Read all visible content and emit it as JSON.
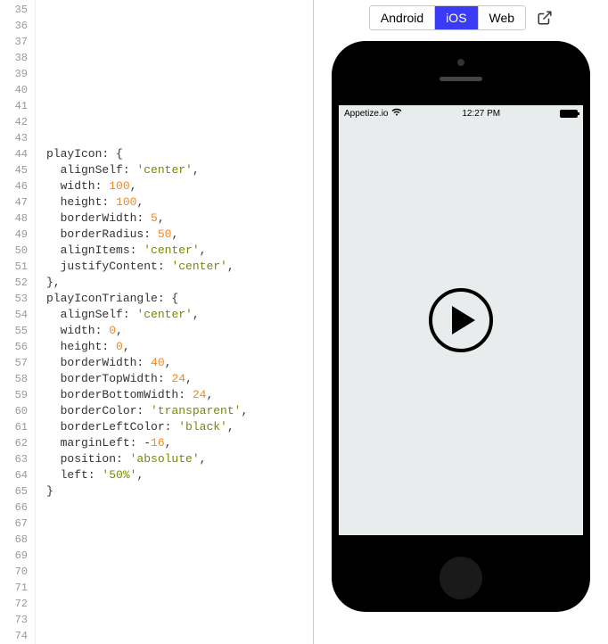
{
  "editor": {
    "startLine": 35,
    "endLine": 74,
    "lines": [
      {
        "tokens": []
      },
      {
        "tokens": []
      },
      {
        "tokens": []
      },
      {
        "tokens": []
      },
      {
        "tokens": []
      },
      {
        "tokens": []
      },
      {
        "tokens": []
      },
      {
        "tokens": []
      },
      {
        "tokens": []
      },
      {
        "tokens": [
          {
            "t": "key",
            "v": "playIcon"
          },
          {
            "t": "punc",
            "v": ": {"
          }
        ]
      },
      {
        "tokens": [
          {
            "t": "prop",
            "v": "  alignSelf"
          },
          {
            "t": "punc",
            "v": ": "
          },
          {
            "t": "str",
            "v": "'center'"
          },
          {
            "t": "punc",
            "v": ","
          }
        ]
      },
      {
        "tokens": [
          {
            "t": "prop",
            "v": "  width"
          },
          {
            "t": "punc",
            "v": ": "
          },
          {
            "t": "num",
            "v": "100"
          },
          {
            "t": "punc",
            "v": ","
          }
        ]
      },
      {
        "tokens": [
          {
            "t": "prop",
            "v": "  height"
          },
          {
            "t": "punc",
            "v": ": "
          },
          {
            "t": "num",
            "v": "100"
          },
          {
            "t": "punc",
            "v": ","
          }
        ]
      },
      {
        "tokens": [
          {
            "t": "prop",
            "v": "  borderWidth"
          },
          {
            "t": "punc",
            "v": ": "
          },
          {
            "t": "num",
            "v": "5"
          },
          {
            "t": "punc",
            "v": ","
          }
        ]
      },
      {
        "tokens": [
          {
            "t": "prop",
            "v": "  borderRadius"
          },
          {
            "t": "punc",
            "v": ": "
          },
          {
            "t": "num",
            "v": "50"
          },
          {
            "t": "punc",
            "v": ","
          }
        ]
      },
      {
        "tokens": [
          {
            "t": "prop",
            "v": "  alignItems"
          },
          {
            "t": "punc",
            "v": ": "
          },
          {
            "t": "str",
            "v": "'center'"
          },
          {
            "t": "punc",
            "v": ","
          }
        ]
      },
      {
        "tokens": [
          {
            "t": "prop",
            "v": "  justifyContent"
          },
          {
            "t": "punc",
            "v": ": "
          },
          {
            "t": "str",
            "v": "'center'"
          },
          {
            "t": "punc",
            "v": ","
          }
        ]
      },
      {
        "tokens": [
          {
            "t": "punc",
            "v": "},"
          }
        ]
      },
      {
        "tokens": [
          {
            "t": "key",
            "v": "playIconTriangle"
          },
          {
            "t": "punc",
            "v": ": {"
          }
        ]
      },
      {
        "tokens": [
          {
            "t": "prop",
            "v": "  alignSelf"
          },
          {
            "t": "punc",
            "v": ": "
          },
          {
            "t": "str",
            "v": "'center'"
          },
          {
            "t": "punc",
            "v": ","
          }
        ]
      },
      {
        "tokens": [
          {
            "t": "prop",
            "v": "  width"
          },
          {
            "t": "punc",
            "v": ": "
          },
          {
            "t": "num",
            "v": "0"
          },
          {
            "t": "punc",
            "v": ","
          }
        ]
      },
      {
        "tokens": [
          {
            "t": "prop",
            "v": "  height"
          },
          {
            "t": "punc",
            "v": ": "
          },
          {
            "t": "num",
            "v": "0"
          },
          {
            "t": "punc",
            "v": ","
          }
        ]
      },
      {
        "tokens": [
          {
            "t": "prop",
            "v": "  borderWidth"
          },
          {
            "t": "punc",
            "v": ": "
          },
          {
            "t": "num",
            "v": "40"
          },
          {
            "t": "punc",
            "v": ","
          }
        ]
      },
      {
        "tokens": [
          {
            "t": "prop",
            "v": "  borderTopWidth"
          },
          {
            "t": "punc",
            "v": ": "
          },
          {
            "t": "num",
            "v": "24"
          },
          {
            "t": "punc",
            "v": ","
          }
        ]
      },
      {
        "tokens": [
          {
            "t": "prop",
            "v": "  borderBottomWidth"
          },
          {
            "t": "punc",
            "v": ": "
          },
          {
            "t": "num",
            "v": "24"
          },
          {
            "t": "punc",
            "v": ","
          }
        ]
      },
      {
        "tokens": [
          {
            "t": "prop",
            "v": "  borderColor"
          },
          {
            "t": "punc",
            "v": ": "
          },
          {
            "t": "str",
            "v": "'transparent'"
          },
          {
            "t": "punc",
            "v": ","
          }
        ]
      },
      {
        "tokens": [
          {
            "t": "prop",
            "v": "  borderLeftColor"
          },
          {
            "t": "punc",
            "v": ": "
          },
          {
            "t": "str",
            "v": "'black'"
          },
          {
            "t": "punc",
            "v": ","
          }
        ]
      },
      {
        "tokens": [
          {
            "t": "prop",
            "v": "  marginLeft"
          },
          {
            "t": "punc",
            "v": ": "
          },
          {
            "t": "punc",
            "v": "-"
          },
          {
            "t": "num",
            "v": "16"
          },
          {
            "t": "punc",
            "v": ","
          }
        ]
      },
      {
        "tokens": [
          {
            "t": "prop",
            "v": "  position"
          },
          {
            "t": "punc",
            "v": ": "
          },
          {
            "t": "str",
            "v": "'absolute'"
          },
          {
            "t": "punc",
            "v": ","
          }
        ]
      },
      {
        "tokens": [
          {
            "t": "prop",
            "v": "  left"
          },
          {
            "t": "punc",
            "v": ": "
          },
          {
            "t": "str",
            "v": "'50%'"
          },
          {
            "t": "punc",
            "v": ","
          }
        ]
      },
      {
        "tokens": [
          {
            "t": "punc",
            "v": "}"
          }
        ]
      },
      {
        "tokens": []
      },
      {
        "tokens": []
      },
      {
        "tokens": []
      },
      {
        "tokens": []
      },
      {
        "tokens": []
      },
      {
        "tokens": []
      },
      {
        "tokens": []
      },
      {
        "tokens": []
      },
      {
        "tokens": []
      }
    ]
  },
  "preview": {
    "tabs": {
      "android": "Android",
      "ios": "iOS",
      "web": "Web"
    },
    "active": "ios",
    "statusBar": {
      "carrier": "Appetize.io",
      "time": "12:27 PM"
    }
  }
}
